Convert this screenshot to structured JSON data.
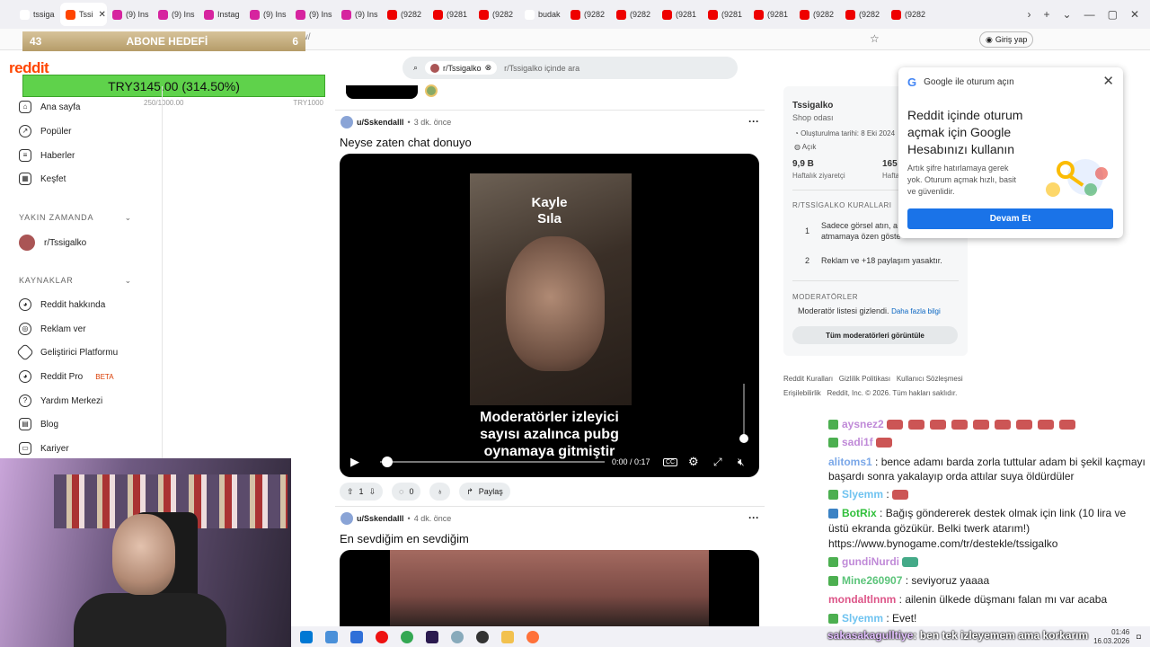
{
  "browser": {
    "tabs": [
      {
        "label": "tssiga",
        "color": "#fff"
      },
      {
        "label": "Tssi",
        "color": "#ff4500",
        "active": true
      },
      {
        "label": "(9) Ins",
        "color": "#d6249f"
      },
      {
        "label": "(9) Ins",
        "color": "#d6249f"
      },
      {
        "label": "Instag",
        "color": "#d6249f"
      },
      {
        "label": "(9) Ins",
        "color": "#d6249f"
      },
      {
        "label": "(9) Ins",
        "color": "#d6249f"
      },
      {
        "label": "(9) Ins",
        "color": "#d6249f"
      },
      {
        "label": "(9282",
        "color": "#e00"
      },
      {
        "label": "(9281",
        "color": "#e00"
      },
      {
        "label": "(9282",
        "color": "#e00"
      },
      {
        "label": "budak",
        "color": "#fff"
      },
      {
        "label": "(9282",
        "color": "#e00"
      },
      {
        "label": "(9282",
        "color": "#e00"
      },
      {
        "label": "(9281",
        "color": "#e00"
      },
      {
        "label": "(9281",
        "color": "#e00"
      },
      {
        "label": "(9281",
        "color": "#e00"
      },
      {
        "label": "(9282",
        "color": "#e00"
      },
      {
        "label": "(9282",
        "color": "#e00"
      },
      {
        "label": "(9282",
        "color": "#e00"
      }
    ],
    "url_fragment": "ew/",
    "login_label": "Giriş yap"
  },
  "overlay": {
    "abone_left": "43",
    "abone_label": "ABONE HEDEFİ",
    "abone_right": "6",
    "donation_label": "TRY3145.00 (314.50%)",
    "donation_sub_left": "250/1000.00",
    "donation_sub_right": "TRY1000"
  },
  "reddit": {
    "logo": "reddit",
    "search_chip": "r/Tssigalko",
    "search_placeholder": "r/Tssigalko içinde ara"
  },
  "sidebar": {
    "items": [
      {
        "label": "Ana sayfa",
        "icon": "home-icon"
      },
      {
        "label": "Popüler",
        "icon": "popular-icon"
      },
      {
        "label": "Haberler",
        "icon": "news-icon"
      },
      {
        "label": "Keşfet",
        "icon": "explore-icon"
      }
    ],
    "recent_heading": "YAKIN ZAMANDA",
    "recent_item": "r/Tssigalko",
    "resources_heading": "KAYNAKLAR",
    "resources": [
      {
        "label": "Reddit hakkında",
        "icon": "reddit-icon"
      },
      {
        "label": "Reklam ver",
        "icon": "ads-icon"
      },
      {
        "label": "Geliştirici Platformu",
        "icon": "developer-icon"
      },
      {
        "label": "Reddit Pro",
        "badge": "BETA",
        "icon": "pro-icon"
      },
      {
        "label": "Yardım Merkezi",
        "icon": "help-icon"
      },
      {
        "label": "Blog",
        "icon": "blog-icon"
      },
      {
        "label": "Kariyer",
        "icon": "career-icon"
      }
    ]
  },
  "posts": [
    {
      "user": "u/Sskendalll",
      "time": "3 dk. önce",
      "title": "Neyse zaten chat donuyo",
      "video_top": "Kayle\nSıla",
      "video_caption": "Moderatörler izleyici sayısı azalınca pubg oynamaya gitmiştir",
      "video_time": "0:00 / 0:17",
      "votes": "1",
      "comments": "0",
      "share": "Paylaş",
      "progress": 0.0
    },
    {
      "user": "u/Sskendalll",
      "time": "4 dk. önce",
      "title": "En sevdiğim en sevdiğim"
    }
  ],
  "subreddit": {
    "name": "Tssigalko",
    "desc": "Shop odası",
    "created": "Oluşturulma tarihi: 8 Eki 2024",
    "status": "Açık",
    "visitors": "9,9 B",
    "visitors_label": "Haftalık ziyaretçi",
    "contrib": "165",
    "contrib_label": "Hafta",
    "rules_heading": "R/TSSİGALKO KURALLARI",
    "rule1_num": "1",
    "rule1": "Sadece görsel atın, a atmamaya özen göste",
    "rule2_num": "2",
    "rule2": "Reklam ve +18 paylaşım yasaktır.",
    "mods_heading": "MODERATÖRLER",
    "mods_hidden": "Moderatör listesi gizlendi.",
    "mods_more": "Daha fazla bilgi",
    "mods_button": "Tüm moderatörleri görüntüle",
    "footer1": "Reddit Kuralları   Gizlilik Politikası   Kullanıcı Sözleşmesi",
    "footer2": "Erişilebilirlik   Reddit, Inc. © 2026. Tüm hakları saklıdır."
  },
  "google": {
    "header": "Google ile oturum açın",
    "title": "Reddit içinde oturum açmak için Google Hesabınızı kullanın",
    "desc": "Artık şifre hatırlamaya gerek yok. Oturum açmak hızlı, basit ve güvenlidir.",
    "button": "Devam Et"
  },
  "chat": [
    {
      "name": "aysnez2",
      "text": ""
    },
    {
      "name": "sadi1f",
      "text": ""
    },
    {
      "name": "alitoms1",
      "text": "bence adamı barda zorla tuttular adam bi şekil kaçmayı başardı sonra yakalayıp orda attılar suya öldürdüler"
    },
    {
      "name": "Slyemm",
      "text": ""
    },
    {
      "name": "BotRix",
      "text": "Bağış göndererek destek olmak için link (10 lira ve üstü ekranda gözükür. Belki twerk atarım!) https://www.bynogame.com/tr/destekle/tssigalko"
    },
    {
      "name": "gundiNurdi",
      "text": ""
    },
    {
      "name": "Mine260907",
      "text": "seviyoruz yaaaa"
    },
    {
      "name": "mondaltlnnm",
      "text": "ailenin ülkede düşmanı falan mı var acaba"
    },
    {
      "name": "Slyemm",
      "text": "Evet!"
    },
    {
      "name": "sakasakagulltiye",
      "text": "ben tek izleyemem ama korkarım"
    }
  ],
  "taskbar": {
    "clock": "01:46",
    "date": "16.03.2026"
  }
}
